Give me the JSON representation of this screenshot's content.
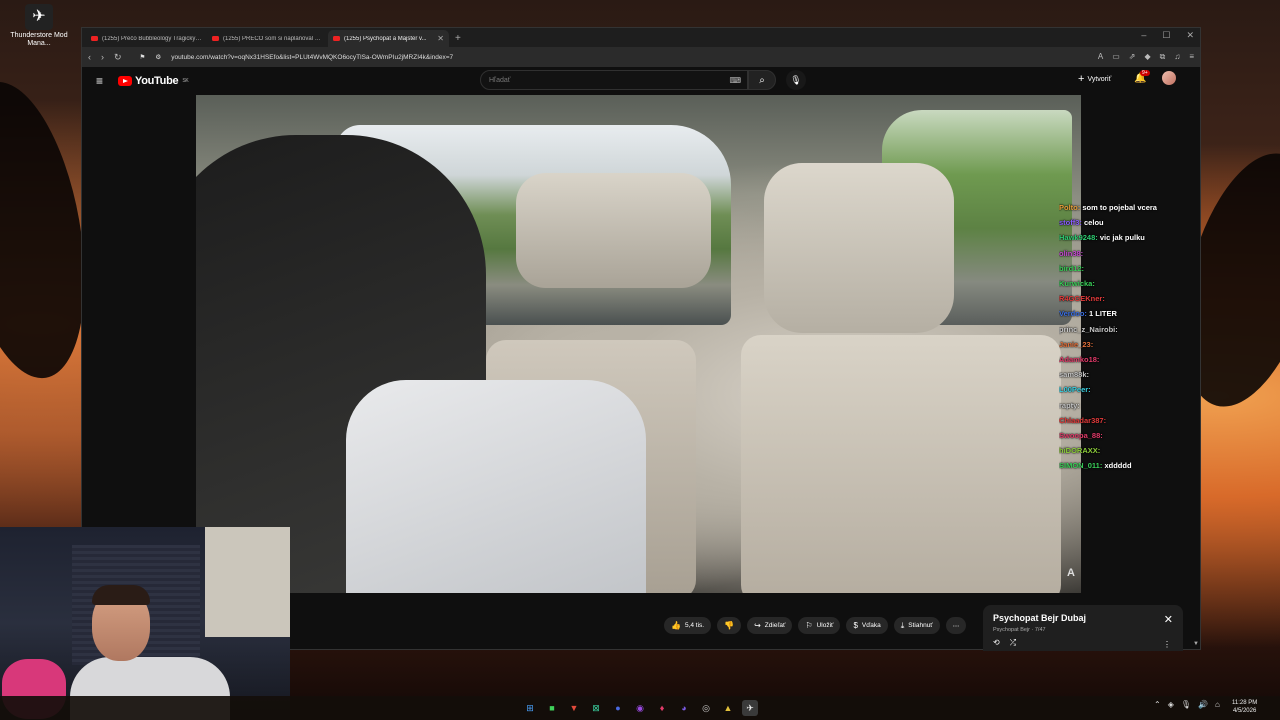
{
  "desktop": {
    "icon_label": "Thunderstore Mod Mana..."
  },
  "browser": {
    "tabs": [
      {
        "title": "(1255) Prečo Bubbleology Tragický Z...",
        "active": false
      },
      {
        "title": "(1255) PREČO som si naplánoval vlastné...",
        "active": false
      },
      {
        "title": "(1255) Psychopat a Majster v...",
        "active": true
      }
    ],
    "url": "youtube.com/watch?v=oqNx31HSEfo&list=PLUt4WvMQKO6ocyTlSa-OWmPIu2jMRZI4k&index=7"
  },
  "youtube": {
    "logo": "YouTube",
    "country": "SK",
    "search_placeholder": "Hľadať",
    "create_label": "Vytvoriť",
    "notif_count": "9+"
  },
  "chat": [
    {
      "user": "Polto:",
      "msg": "som to pojebal vcera",
      "color": "#e9a13b"
    },
    {
      "user": "stoff3:",
      "msg": "celou",
      "color": "#8a5cff"
    },
    {
      "user": "Hawk9248:",
      "msg": "vic jak pulku",
      "color": "#2ecc71"
    },
    {
      "user": "olin38:",
      "msg": "",
      "color": "#c94bd6"
    },
    {
      "user": "bird12:",
      "msg": "",
      "color": "#3bd15a"
    },
    {
      "user": "Kurwicka:",
      "msg": "",
      "color": "#3bd15a"
    },
    {
      "user": "R4GGEKner:",
      "msg": "",
      "color": "#e23b3b"
    },
    {
      "user": "Verdoo:",
      "msg": "1 LITER",
      "color": "#3b6fe2"
    },
    {
      "user": "princ_z_Nairobi:",
      "msg": "",
      "color": "#c9c9c9"
    },
    {
      "user": "Janie_23:",
      "msg": "",
      "color": "#e2703b"
    },
    {
      "user": "Adamko18:",
      "msg": "",
      "color": "#e23b6a"
    },
    {
      "user": "sam88k:",
      "msg": "",
      "color": "#c9c9c9"
    },
    {
      "user": "L00Peer:",
      "msg": "",
      "color": "#3bd1e2"
    },
    {
      "user": "rapty:",
      "msg": "",
      "color": "#c9c9c9"
    },
    {
      "user": "Chlaadar387:",
      "msg": "",
      "color": "#e23b3b"
    },
    {
      "user": "Swoopa_88:",
      "msg": "",
      "color": "#e23b6a"
    },
    {
      "user": "hiDORAXX:",
      "msg": "",
      "color": "#8fd13b"
    },
    {
      "user": "SIMON_011:",
      "msg": "xddddd",
      "color": "#3bd15a"
    }
  ],
  "actions": {
    "likes": "5,4 tis.",
    "share": "Zdieľať",
    "save": "Uložiť",
    "thanks": "Vďaka",
    "download": "Stiahnuť"
  },
  "playlist": {
    "title": "Psychopat Bejr  Dubaj",
    "subtitle": "Psychopat Bejr · 7/47"
  },
  "taskbar": {
    "time": "11:28 PM",
    "date": "4/5/2026"
  }
}
